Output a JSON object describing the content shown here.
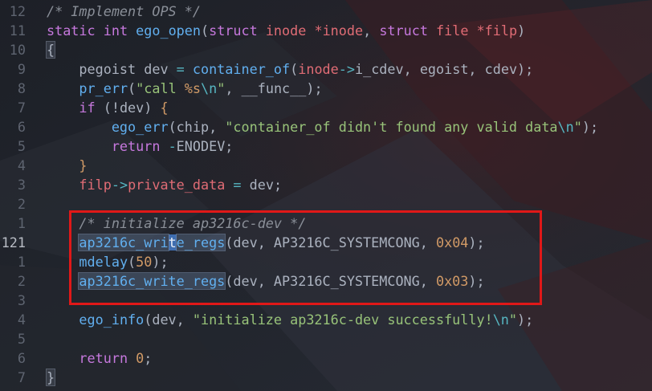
{
  "editor": {
    "colors": {
      "background": "#20232a",
      "keyword": "#c678dd",
      "function": "#61afef",
      "variable": "#e06c75",
      "string": "#98c379",
      "number": "#d19a66",
      "comment": "#8a8f98",
      "annotation_box": "#e01818"
    },
    "lines": [
      {
        "num": "12",
        "tokens": [
          {
            "t": "/* Implement OPS */",
            "c": "comment"
          }
        ]
      },
      {
        "num": "11",
        "tokens": [
          {
            "t": "static",
            "c": "kw"
          },
          {
            "t": " "
          },
          {
            "t": "int",
            "c": "kw"
          },
          {
            "t": " "
          },
          {
            "t": "ego_open",
            "c": "fn"
          },
          {
            "t": "("
          },
          {
            "t": "struct",
            "c": "kw"
          },
          {
            "t": " "
          },
          {
            "t": "inode",
            "c": "var"
          },
          {
            "t": " "
          },
          {
            "t": "*inode",
            "c": "var"
          },
          {
            "t": ", "
          },
          {
            "t": "struct",
            "c": "kw"
          },
          {
            "t": " "
          },
          {
            "t": "file",
            "c": "var"
          },
          {
            "t": " "
          },
          {
            "t": "*filp",
            "c": "var"
          },
          {
            "t": ")"
          }
        ]
      },
      {
        "num": "10",
        "tokens": [
          {
            "t": "{",
            "c": "bracketmatch"
          }
        ]
      },
      {
        "num": "9",
        "tokens": [
          {
            "t": "    pegoist dev "
          },
          {
            "t": "=",
            "c": "op"
          },
          {
            "t": " "
          },
          {
            "t": "container_of",
            "c": "fn"
          },
          {
            "t": "("
          },
          {
            "t": "inode",
            "c": "var"
          },
          {
            "t": "->",
            "c": "op"
          },
          {
            "t": "i_cdev"
          },
          {
            "t": ", egoist, cdev);"
          }
        ]
      },
      {
        "num": "8",
        "tokens": [
          {
            "t": "    "
          },
          {
            "t": "pr_err",
            "c": "fn"
          },
          {
            "t": "("
          },
          {
            "t": "\"call ",
            "c": "str"
          },
          {
            "t": "%s",
            "c": "num"
          },
          {
            "t": "\\n",
            "c": "op"
          },
          {
            "t": "\"",
            "c": "str"
          },
          {
            "t": ", __func__);"
          }
        ]
      },
      {
        "num": "7",
        "tokens": [
          {
            "t": "    "
          },
          {
            "t": "if",
            "c": "kw"
          },
          {
            "t": " (!dev) "
          },
          {
            "t": "{",
            "c": "brace"
          }
        ]
      },
      {
        "num": "6",
        "tokens": [
          {
            "t": "        "
          },
          {
            "t": "ego_err",
            "c": "fn"
          },
          {
            "t": "(chip, "
          },
          {
            "t": "\"container_of didn't found any valid data",
            "c": "str"
          },
          {
            "t": "\\n",
            "c": "op"
          },
          {
            "t": "\"",
            "c": "str"
          },
          {
            "t": ");"
          }
        ]
      },
      {
        "num": "5",
        "tokens": [
          {
            "t": "        "
          },
          {
            "t": "return",
            "c": "kw"
          },
          {
            "t": " "
          },
          {
            "t": "-",
            "c": "op"
          },
          {
            "t": "ENODEV;"
          }
        ]
      },
      {
        "num": "4",
        "tokens": [
          {
            "t": "    "
          },
          {
            "t": "}",
            "c": "brace"
          }
        ]
      },
      {
        "num": "3",
        "tokens": [
          {
            "t": "    "
          },
          {
            "t": "filp",
            "c": "var"
          },
          {
            "t": "->",
            "c": "op"
          },
          {
            "t": "private_data",
            "c": "var"
          },
          {
            "t": " "
          },
          {
            "t": "=",
            "c": "op"
          },
          {
            "t": " dev;"
          }
        ]
      },
      {
        "num": "2",
        "tokens": []
      },
      {
        "num": "1",
        "tokens": [
          {
            "t": "    "
          },
          {
            "t": "/* initialize ap3216c-dev */",
            "c": "comment"
          }
        ]
      },
      {
        "num": "121",
        "current": true,
        "tokens": [
          {
            "t": "    "
          },
          {
            "t": "ap3216c_wri",
            "c": "hl"
          },
          {
            "t": "t",
            "c": "cursor"
          },
          {
            "t": "e_regs",
            "c": "hl"
          },
          {
            "t": "(dev, AP3216C_SYSTEMCONG, "
          },
          {
            "t": "0x04",
            "c": "num"
          },
          {
            "t": ");"
          }
        ]
      },
      {
        "num": "1",
        "tokens": [
          {
            "t": "    "
          },
          {
            "t": "mdelay",
            "c": "fn"
          },
          {
            "t": "("
          },
          {
            "t": "50",
            "c": "num"
          },
          {
            "t": ");"
          }
        ]
      },
      {
        "num": "2",
        "tokens": [
          {
            "t": "    "
          },
          {
            "t": "ap3216c_write_regs",
            "c": "hl"
          },
          {
            "t": "(dev, AP3216C_SYSTEMCONG, "
          },
          {
            "t": "0x03",
            "c": "num"
          },
          {
            "t": ");"
          }
        ]
      },
      {
        "num": "3",
        "tokens": []
      },
      {
        "num": "4",
        "tokens": [
          {
            "t": "    "
          },
          {
            "t": "ego_info",
            "c": "fn"
          },
          {
            "t": "(dev, "
          },
          {
            "t": "\"initialize ap3216c-dev successfully!",
            "c": "str"
          },
          {
            "t": "\\n",
            "c": "op"
          },
          {
            "t": "\"",
            "c": "str"
          },
          {
            "t": ");"
          }
        ]
      },
      {
        "num": "5",
        "tokens": []
      },
      {
        "num": "6",
        "tokens": [
          {
            "t": "    "
          },
          {
            "t": "return",
            "c": "kw"
          },
          {
            "t": " "
          },
          {
            "t": "0",
            "c": "num"
          },
          {
            "t": ";"
          }
        ]
      },
      {
        "num": "7",
        "tokens": [
          {
            "t": "}",
            "c": "bracketmatch"
          }
        ]
      }
    ]
  }
}
